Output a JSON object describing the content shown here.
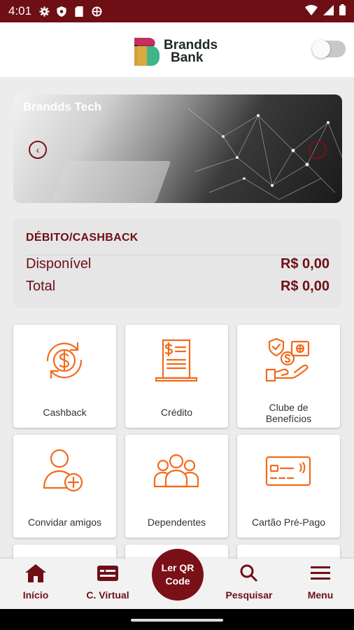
{
  "status_bar": {
    "time": "4:01"
  },
  "header": {
    "logo_line1": "Brandds",
    "logo_line2": "Bank",
    "brand_color": "#6e0f16"
  },
  "banner": {
    "title": "Brandds Tech"
  },
  "balance": {
    "title": "DÉBITO/CASHBACK",
    "rows": [
      {
        "label": "Disponível",
        "value": "R$ 0,00"
      },
      {
        "label": "Total",
        "value": "R$ 0,00"
      }
    ]
  },
  "tiles": [
    {
      "label": "Cashback",
      "icon": "cashback-icon"
    },
    {
      "label": "Crédito",
      "icon": "credit-receipt-icon"
    },
    {
      "label_line1": "Clube de",
      "label_line2": "Benefícios",
      "icon": "benefits-club-icon"
    },
    {
      "label": "Convidar amigos",
      "icon": "invite-friend-icon"
    },
    {
      "label": "Dependentes",
      "icon": "dependents-icon"
    },
    {
      "label": "Cartão Pré-Pago",
      "icon": "prepaid-card-icon"
    }
  ],
  "nav": {
    "home": "Início",
    "virtual_card": "C. Virtual",
    "qr_line1": "Ler QR",
    "qr_line2": "Code",
    "search": "Pesquisar",
    "menu": "Menu"
  },
  "accent_color": "#f26a1b"
}
